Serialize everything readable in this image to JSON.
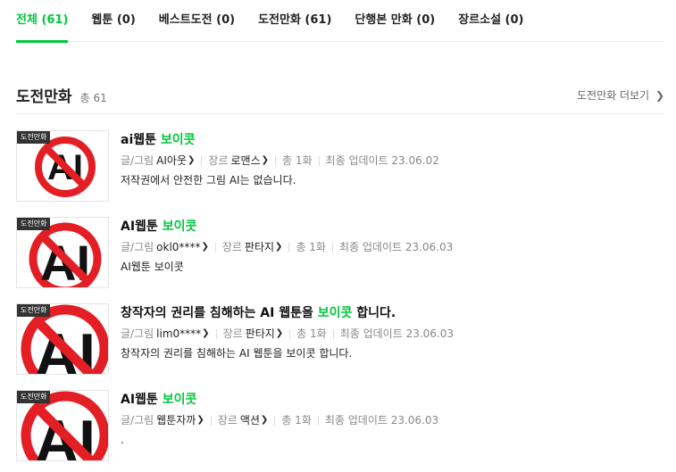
{
  "tabs": [
    {
      "label": "전체 (61)",
      "active": true
    },
    {
      "label": "웹툰 (0)",
      "active": false
    },
    {
      "label": "베스트도전 (0)",
      "active": false
    },
    {
      "label": "도전만화 (61)",
      "active": false
    },
    {
      "label": "단행본 만화 (0)",
      "active": false
    },
    {
      "label": "장르소설 (0)",
      "active": false
    }
  ],
  "section": {
    "title": "도전만화",
    "count": "총 61",
    "more_label": "도전만화 더보기",
    "more_icon": "chevron-right-icon"
  },
  "colors": {
    "accent": "#00c73c",
    "badge_bg": "#333333",
    "ban_red": "#e31e24"
  },
  "items": [
    {
      "badge": "도전만화",
      "thumb_icon": "ai-ban-icon",
      "title_pre": "ai웹툰 ",
      "title_accent": "보이콧",
      "title_post": "",
      "author_label": "글/그림",
      "author": "AI아웃",
      "genre_label": "장르",
      "genre": "로맨스",
      "episodes": "총 1화",
      "updated": "최종 업데이트 23.06.02",
      "desc": "저작권에서 안전한 그림 AI는 없습니다."
    },
    {
      "badge": "도전만화",
      "thumb_icon": "ai-ban-icon",
      "title_pre": "AI웹툰 ",
      "title_accent": "보이콧",
      "title_post": "",
      "author_label": "글/그림",
      "author": "okl0****",
      "genre_label": "장르",
      "genre": "판타지",
      "episodes": "총 1화",
      "updated": "최종 업데이트 23.06.03",
      "desc": "AI웹툰 보이콧"
    },
    {
      "badge": "도전만화",
      "thumb_icon": "ai-ban-icon",
      "title_pre": "창작자의 권리를 침해하는 AI 웹툰을 ",
      "title_accent": "보이콧",
      "title_post": " 합니다.",
      "author_label": "글/그림",
      "author": "lim0****",
      "genre_label": "장르",
      "genre": "판타지",
      "episodes": "총 1화",
      "updated": "최종 업데이트 23.06.03",
      "desc": "창작자의 권리를 침해하는 AI 웹툰을 보이콧 합니다."
    },
    {
      "badge": "도전만화",
      "thumb_icon": "ai-ban-icon",
      "title_pre": "AI웹툰 ",
      "title_accent": "보이콧",
      "title_post": "",
      "author_label": "글/그림",
      "author": "웹툰자까",
      "genre_label": "장르",
      "genre": "액션",
      "episodes": "총 1화",
      "updated": "최종 업데이트 23.06.03",
      "desc": "."
    }
  ]
}
